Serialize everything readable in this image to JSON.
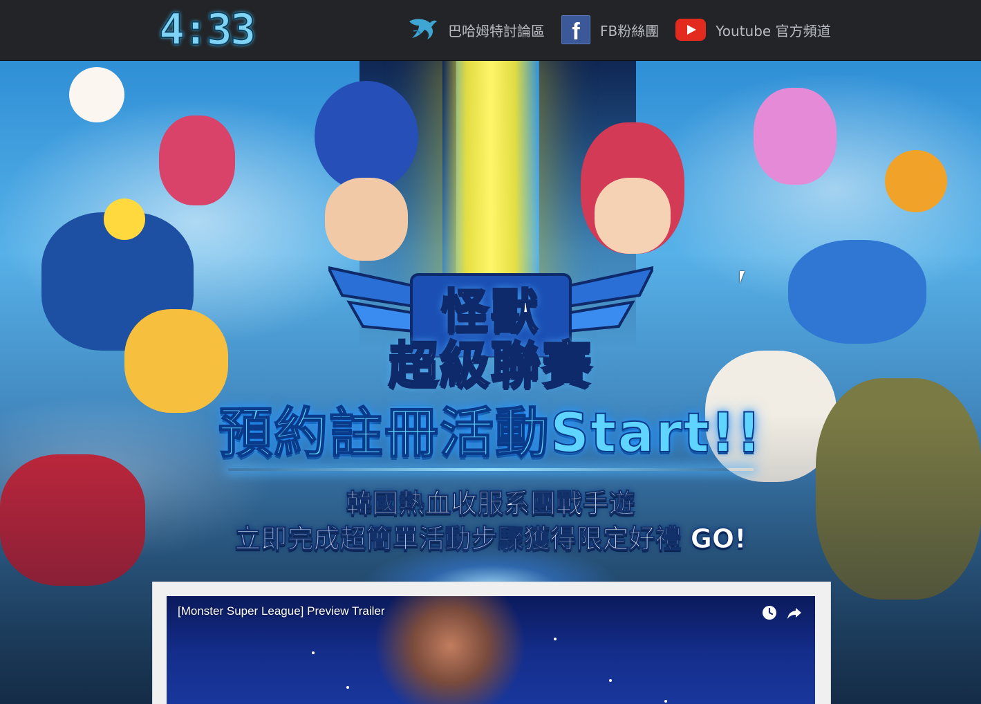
{
  "header": {
    "logo_text": "4:33",
    "links": [
      {
        "label": "巴哈姆特討論區",
        "icon": "dragon-icon"
      },
      {
        "label": "FB粉絲團",
        "icon": "facebook-icon"
      },
      {
        "label": "Youtube 官方頻道",
        "icon": "youtube-icon"
      }
    ]
  },
  "hero": {
    "game_logo_line1": "怪獸",
    "game_logo_line2": "超級聯賽",
    "headline": "預約註冊活動Start!!",
    "subline1": "韓國熱血收服系團戰手遊",
    "subline2_a": "立即完成超簡單活動步驟",
    "subline2_b": "獲得限定好禮 GO!"
  },
  "video": {
    "title": "[Monster Super League] Preview Trailer",
    "watch_later_icon": "clock-icon",
    "share_icon": "share-icon"
  },
  "colors": {
    "topbar_bg": "#222427",
    "headline": "#5fd4ff",
    "youtube_red": "#e32a1f",
    "facebook_blue": "#3b5998"
  }
}
